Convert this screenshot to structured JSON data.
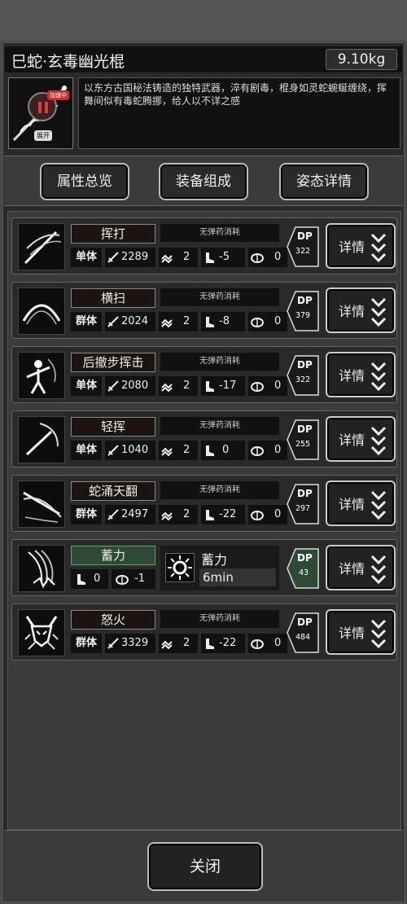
{
  "weapon": {
    "title": "巳蛇·玄毒幽光棍",
    "weight": "9.10kg",
    "description": "以东方古国秘法铸造的独特武器，淬有剧毒，棍身如灵蛇蜿蜒缠绕，挥舞间似有毒蛇腾挪，给人以不详之感",
    "badge_tag": "加速中"
  },
  "expand_label": "展开",
  "tabs": [
    {
      "label": "属性总览"
    },
    {
      "label": "装备组成"
    },
    {
      "label": "姿态详情"
    }
  ],
  "skills": [
    {
      "name": "挥打",
      "ammo": "无弹药消耗",
      "target": "单体",
      "attack": "2289",
      "hits": "2",
      "stance": "-5",
      "stamina": "0",
      "dp_label": "DP",
      "dp": "322",
      "detail": "详情",
      "icon": "swing-icon"
    },
    {
      "name": "横扫",
      "ammo": "无弹药消耗",
      "target": "群体",
      "attack": "2024",
      "hits": "2",
      "stance": "-8",
      "stamina": "0",
      "dp_label": "DP",
      "dp": "379",
      "detail": "详情",
      "icon": "sweep-icon"
    },
    {
      "name": "后撤步挥击",
      "ammo": "无弹药消耗",
      "target": "单体",
      "attack": "2080",
      "hits": "2",
      "stance": "-17",
      "stamina": "0",
      "dp_label": "DP",
      "dp": "322",
      "detail": "详情",
      "icon": "backstep-strike-icon"
    },
    {
      "name": "轻挥",
      "ammo": "无弹药消耗",
      "target": "单体",
      "attack": "1040",
      "hits": "2",
      "stance": "0",
      "stamina": "0",
      "dp_label": "DP",
      "dp": "255",
      "detail": "详情",
      "icon": "light-swing-icon"
    },
    {
      "name": "蛇涌天翻",
      "ammo": "无弹药消耗",
      "target": "群体",
      "attack": "2497",
      "hits": "2",
      "stance": "-22",
      "stamina": "0",
      "dp_label": "DP",
      "dp": "297",
      "detail": "详情",
      "icon": "serpent-surge-icon"
    },
    {
      "name": "蓄力",
      "stance": "0",
      "stamina": "-1",
      "charge_title": "蓄力",
      "charge_time": "6min",
      "dp_label": "DP",
      "dp": "43",
      "detail": "详情",
      "icon": "charge-icon"
    },
    {
      "name": "怒火",
      "ammo": "无弹药消耗",
      "target": "群体",
      "attack": "3329",
      "hits": "2",
      "stance": "-22",
      "stamina": "0",
      "dp_label": "DP",
      "dp": "484",
      "detail": "详情",
      "icon": "fury-icon"
    }
  ],
  "footer": {
    "close_label": "关闭"
  },
  "colors": {
    "panel": "#2a2a2a",
    "charge_green": "#2d4a35",
    "badge_red": "#e03a3a"
  }
}
